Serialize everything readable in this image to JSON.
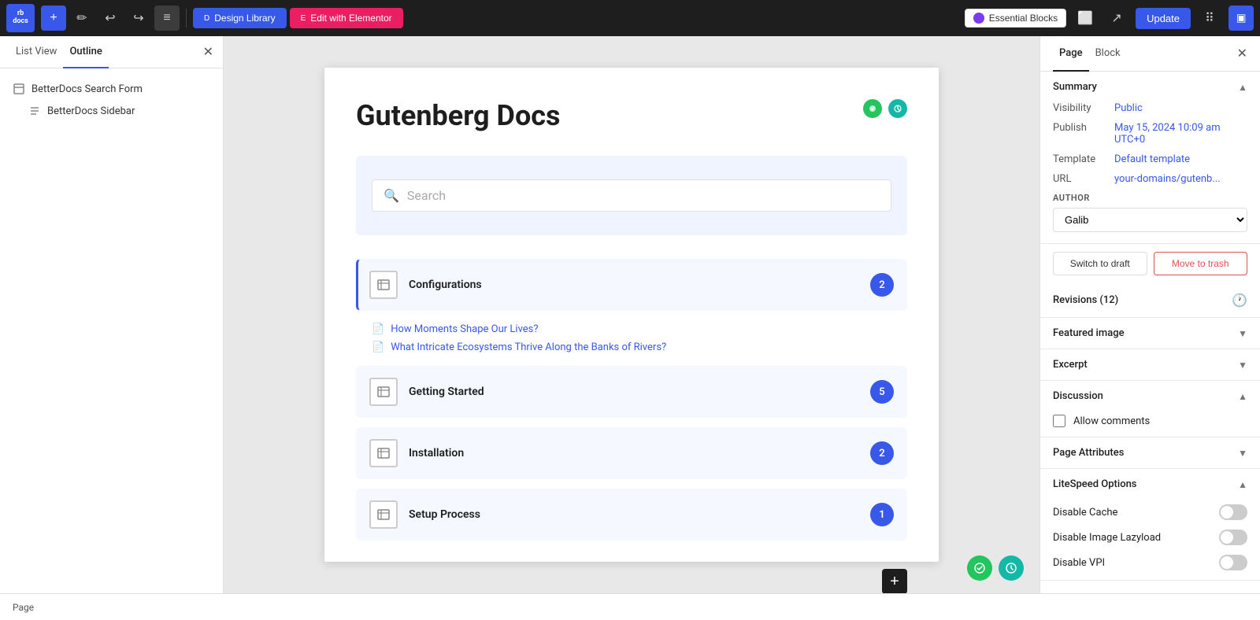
{
  "toolbar": {
    "logo_text": "rb\ndocs",
    "add_label": "+",
    "pencil_label": "✏",
    "undo_label": "↩",
    "redo_label": "↪",
    "menu_label": "≡",
    "design_library_label": "Design Library",
    "edit_elementor_label": "Edit with Elementor",
    "essential_blocks_label": "Essential Blocks",
    "update_label": "Update",
    "view_icon": "□",
    "preview_icon": "↗",
    "settings_icon": "⋮⋮",
    "sidebar_icon": "▣"
  },
  "left_panel": {
    "tabs": [
      "List View",
      "Outline"
    ],
    "active_tab": "Outline",
    "outline_items": [
      {
        "label": "BetterDocs Search Form",
        "type": "block"
      },
      {
        "label": "BetterDocs Sidebar",
        "type": "block"
      }
    ]
  },
  "page": {
    "title": "Gutenberg Docs",
    "search_placeholder": "Search",
    "categories": [
      {
        "name": "Configurations",
        "count": 2,
        "active": true,
        "docs": [
          "How Moments Shape Our Lives?",
          "What Intricate Ecosystems Thrive Along the Banks of Rivers?"
        ]
      },
      {
        "name": "Getting Started",
        "count": 5,
        "active": false,
        "docs": []
      },
      {
        "name": "Installation",
        "count": 2,
        "active": false,
        "docs": []
      },
      {
        "name": "Setup Process",
        "count": 1,
        "active": false,
        "docs": []
      }
    ]
  },
  "right_panel": {
    "tabs": [
      "Page",
      "Block"
    ],
    "active_tab": "Page",
    "summary": {
      "label": "Summary",
      "visibility_label": "Visibility",
      "visibility_value": "Public",
      "publish_label": "Publish",
      "publish_value": "May 15, 2024 10:09 am UTC+0",
      "template_label": "Template",
      "template_value": "Default template",
      "url_label": "URL",
      "url_value": "your-domains/gutenb...",
      "author_label": "AUTHOR",
      "author_value": "Galib"
    },
    "actions": {
      "switch_draft": "Switch to draft",
      "move_trash": "Move to trash"
    },
    "revisions": {
      "label": "Revisions (12)"
    },
    "featured_image": {
      "label": "Featured image"
    },
    "excerpt": {
      "label": "Excerpt"
    },
    "discussion": {
      "label": "Discussion",
      "allow_comments_label": "Allow comments"
    },
    "page_attributes": {
      "label": "Page Attributes"
    },
    "litespeed": {
      "label": "LiteSpeed Options",
      "disable_cache_label": "Disable Cache",
      "disable_image_lazyload_label": "Disable Image Lazyload",
      "disable_vpi_label": "Disable VPI"
    }
  },
  "bottom_bar": {
    "label": "Page"
  }
}
